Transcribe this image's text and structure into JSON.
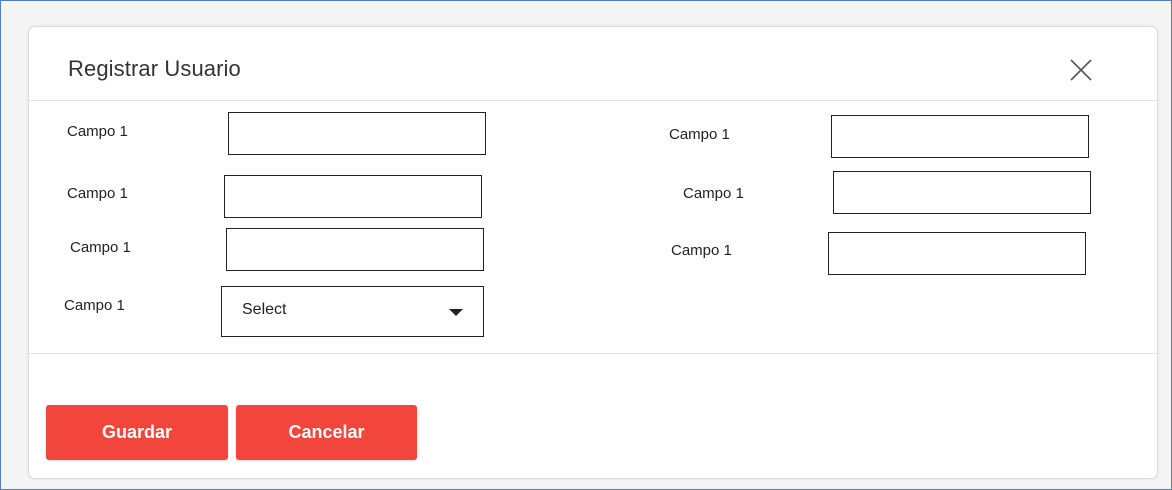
{
  "modal": {
    "title": "Registrar Usuario",
    "close_icon": "close-icon"
  },
  "form": {
    "left": [
      {
        "label": "Campo 1",
        "value": ""
      },
      {
        "label": "Campo 1",
        "value": ""
      },
      {
        "label": "Campo 1",
        "value": ""
      }
    ],
    "right": [
      {
        "label": "Campo 1",
        "value": ""
      },
      {
        "label": "Campo 1",
        "value": ""
      },
      {
        "label": "Campo 1",
        "value": ""
      }
    ],
    "select": {
      "label": "Campo 1",
      "selected": "Select",
      "icon": "chevron-down-icon"
    }
  },
  "footer": {
    "save_label": "Guardar",
    "cancel_label": "Cancelar"
  },
  "colors": {
    "accent": "#f2453b",
    "frame_border": "#4a80bf"
  }
}
